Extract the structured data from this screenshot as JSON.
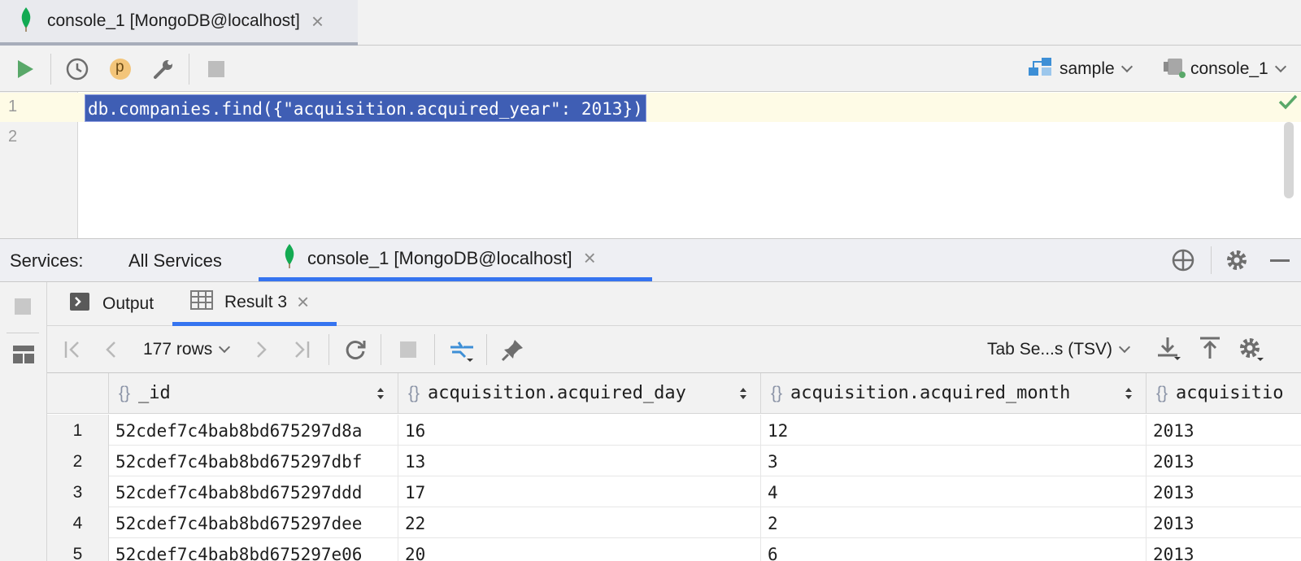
{
  "editor_tab": {
    "title": "console_1 [MongoDB@localhost]"
  },
  "toolbar": {
    "run_icon": "play-icon",
    "history_icon": "clock-icon",
    "profile_badge": "p",
    "settings_icon": "wrench-icon",
    "stop_icon": "stop-icon",
    "database_select": "sample",
    "console_select": "console_1"
  },
  "editor": {
    "lines": [
      "1",
      "2"
    ],
    "code": "db.companies.find({\"acquisition.acquired_year\": 2013})"
  },
  "services": {
    "label": "Services:",
    "all": "All Services",
    "active_tab": "console_1 [MongoDB@localhost]"
  },
  "result_tabs": {
    "output": "Output",
    "result": "Result 3"
  },
  "result_toolbar": {
    "rows": "177 rows",
    "export_format": "Tab Se...s (TSV)"
  },
  "table": {
    "columns": [
      "_id",
      "acquisition.acquired_day",
      "acquisition.acquired_month",
      "acquisitio"
    ],
    "rows": [
      {
        "n": "1",
        "id": "52cdef7c4bab8bd675297d8a",
        "day": "16",
        "month": "12",
        "year": "2013"
      },
      {
        "n": "2",
        "id": "52cdef7c4bab8bd675297dbf",
        "day": "13",
        "month": "3",
        "year": "2013"
      },
      {
        "n": "3",
        "id": "52cdef7c4bab8bd675297ddd",
        "day": "17",
        "month": "4",
        "year": "2013"
      },
      {
        "n": "4",
        "id": "52cdef7c4bab8bd675297dee",
        "day": "22",
        "month": "2",
        "year": "2013"
      },
      {
        "n": "5",
        "id": "52cdef7c4bab8bd675297e06",
        "day": "20",
        "month": "6",
        "year": "2013"
      }
    ]
  },
  "colors": {
    "accent": "#3574f0",
    "selection": "#3f5eb4",
    "mongo_green": "#13aa52",
    "run_green": "#59a869"
  }
}
